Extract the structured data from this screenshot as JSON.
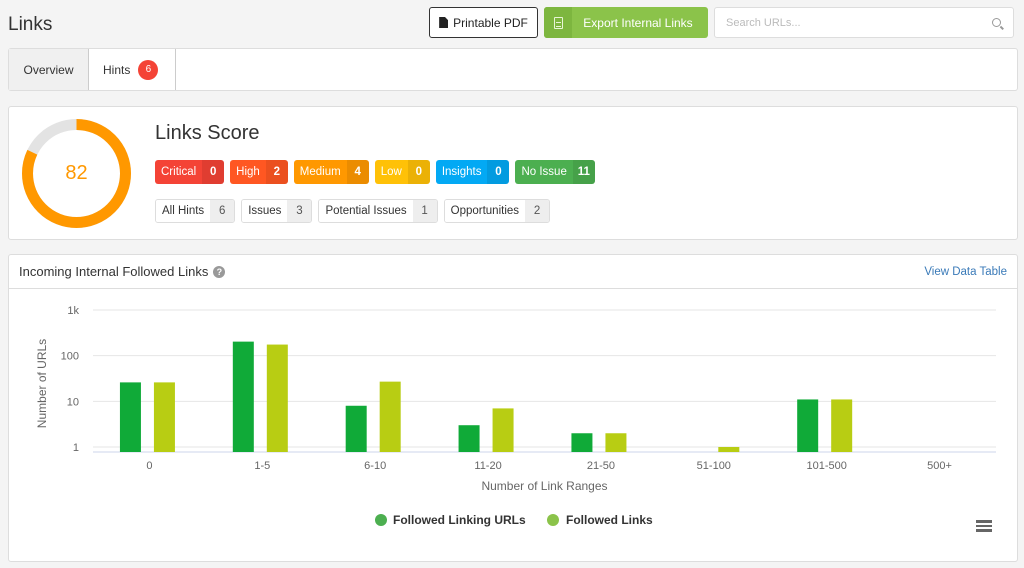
{
  "header": {
    "title": "Links",
    "pdf_button": "Printable PDF",
    "export_button": "Export Internal Links",
    "search_placeholder": "Search URLs...",
    "search_value": ""
  },
  "tabs": [
    {
      "label": "Overview",
      "active": true
    },
    {
      "label": "Hints",
      "badge": "6",
      "active": false
    }
  ],
  "score": {
    "title": "Links Score",
    "value": 82,
    "max": 100,
    "color": "#ff9800",
    "severities": [
      {
        "label": "Critical",
        "count": "0",
        "color": "#f44336"
      },
      {
        "label": "High",
        "count": "2",
        "color": "#ff5722"
      },
      {
        "label": "Medium",
        "count": "4",
        "color": "#ff9800"
      },
      {
        "label": "Low",
        "count": "0",
        "color": "#ffc107"
      },
      {
        "label": "Insights",
        "count": "0",
        "color": "#03a9f4"
      },
      {
        "label": "No Issue",
        "count": "11",
        "color": "#4caf50"
      }
    ],
    "types": [
      {
        "label": "All Hints",
        "count": "6"
      },
      {
        "label": "Issues",
        "count": "3"
      },
      {
        "label": "Potential Issues",
        "count": "1"
      },
      {
        "label": "Opportunities",
        "count": "2"
      }
    ]
  },
  "chart_card": {
    "title": "Incoming Internal Followed Links",
    "view_table": "View Data Table"
  },
  "chart_data": {
    "type": "bar",
    "title": "Incoming Internal Followed Links",
    "xlabel": "Number of Link Ranges",
    "ylabel": "Number of URLs",
    "yscale": "log",
    "ylim": [
      1,
      1000
    ],
    "yticks": [
      "1",
      "10",
      "100",
      "1k"
    ],
    "ytick_values": [
      1,
      10,
      100,
      1000
    ],
    "grid": true,
    "legend": "bottom-center",
    "categories": [
      "0",
      "1-5",
      "6-10",
      "11-20",
      "21-50",
      "51-100",
      "101-500",
      "500+"
    ],
    "series": [
      {
        "name": "Followed Linking URLs",
        "color": "#10aa38",
        "legend_color": "#4caf50",
        "values": [
          26,
          203,
          8,
          3,
          2,
          0,
          11,
          0
        ]
      },
      {
        "name": "Followed Links",
        "color": "#b8cd13",
        "legend_color": "#8bc34a",
        "values": [
          26,
          175,
          27,
          7,
          2,
          1,
          11,
          0
        ]
      }
    ]
  }
}
